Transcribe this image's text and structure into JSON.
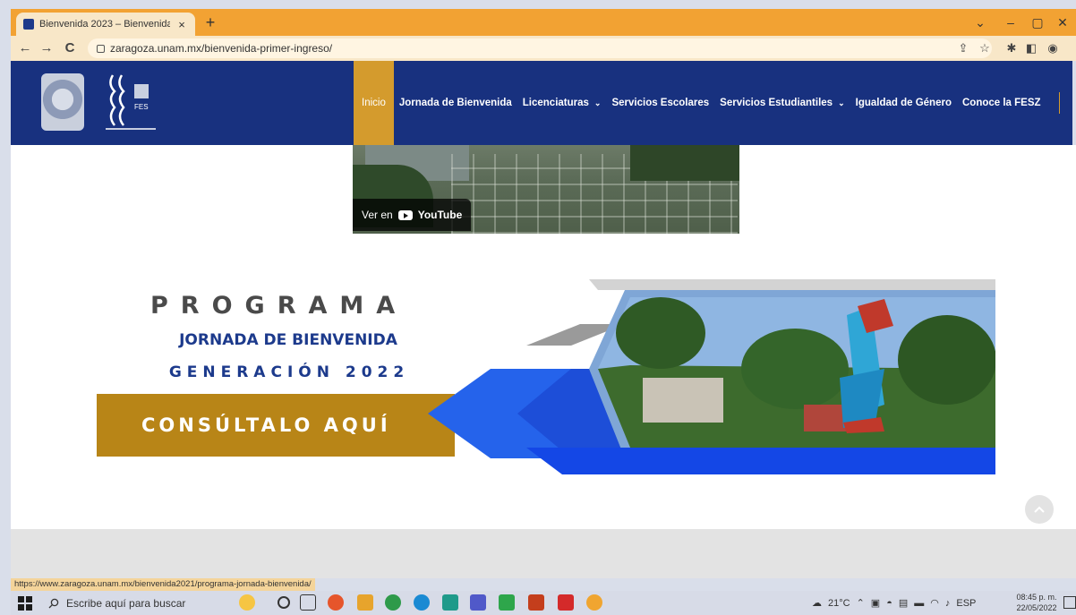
{
  "browser": {
    "tab_title": "Bienvenida 2023 – Bienvenida Ge",
    "new_tab": "+",
    "url": "zaragoza.unam.mx/bienvenida-primer-ingreso/",
    "controls": {
      "minimize": "–",
      "maximize": "▢",
      "close": "✕",
      "tablist": "⌄"
    },
    "nav": {
      "back": "←",
      "forward": "→",
      "reload": "C"
    }
  },
  "site": {
    "nav": [
      {
        "label": "Inicio",
        "active": true
      },
      {
        "label": "Jornada de Bienvenida"
      },
      {
        "label": "Licenciaturas",
        "dropdown": true
      },
      {
        "label": "Servicios Escolares"
      },
      {
        "label": "Servicios Estudiantiles",
        "dropdown": true
      },
      {
        "label": "Igualdad de Género"
      },
      {
        "label": "Conoce la FESZ"
      }
    ],
    "caret": "⌄",
    "logo_text": "FES"
  },
  "video": {
    "watch_on": "Ver en",
    "youtube": "YouTube"
  },
  "banner": {
    "title": "PROGRAMA",
    "subtitle1": "JORNADA DE BIENVENIDA",
    "subtitle2": "GENERACIÓN 2022",
    "cta": "CONSÚLTALO AQUÍ"
  },
  "status_bar": {
    "url": "https://www.zaragoza.unam.mx/bienvenida2021/programa-jornada-bienvenida/"
  },
  "taskbar": {
    "search_placeholder": "Escribe aquí para buscar",
    "weather": "21°C",
    "language": "ESP",
    "time": "08:45 p. m.",
    "date": "22/05/2022"
  },
  "colors": {
    "tab_strip": "#f2a233",
    "header_blue": "#18317f",
    "nav_active": "#d49b2d",
    "cta_gold": "#b88517",
    "banner_blue": "#1c3a8c"
  }
}
